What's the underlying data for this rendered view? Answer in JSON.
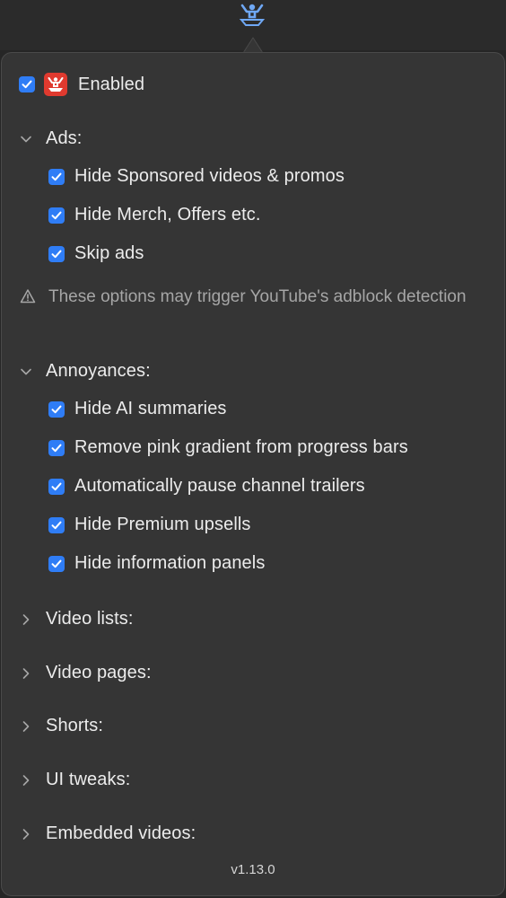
{
  "menubar": {
    "icon": "app-menubar-icon"
  },
  "header": {
    "enabled_label": "Enabled",
    "enabled_checked": true,
    "icon": "app-badge-icon"
  },
  "sections": {
    "ads": {
      "title": "Ads:",
      "expanded": true,
      "items": [
        {
          "label": "Hide Sponsored videos & promos",
          "checked": true
        },
        {
          "label": "Hide Merch, Offers etc.",
          "checked": true
        },
        {
          "label": "Skip ads",
          "checked": true
        }
      ],
      "warning": "These options may trigger YouTube's adblock detection"
    },
    "annoyances": {
      "title": "Annoyances:",
      "expanded": true,
      "items": [
        {
          "label": "Hide AI summaries",
          "checked": true
        },
        {
          "label": "Remove pink gradient from progress bars",
          "checked": true
        },
        {
          "label": "Automatically pause channel trailers",
          "checked": true
        },
        {
          "label": "Hide Premium upsells",
          "checked": true
        },
        {
          "label": "Hide information panels",
          "checked": true
        }
      ]
    },
    "video_lists": {
      "title": "Video lists:",
      "expanded": false
    },
    "video_pages": {
      "title": "Video pages:",
      "expanded": false
    },
    "shorts": {
      "title": "Shorts:",
      "expanded": false
    },
    "ui_tweaks": {
      "title": "UI tweaks:",
      "expanded": false
    },
    "embedded_videos": {
      "title": "Embedded videos:",
      "expanded": false
    }
  },
  "footer": {
    "version": "v1.13.0"
  },
  "colors": {
    "accent": "#2f7df6",
    "badge": "#e03a2f",
    "background": "#353535",
    "muted_text": "#a6a6a6"
  }
}
